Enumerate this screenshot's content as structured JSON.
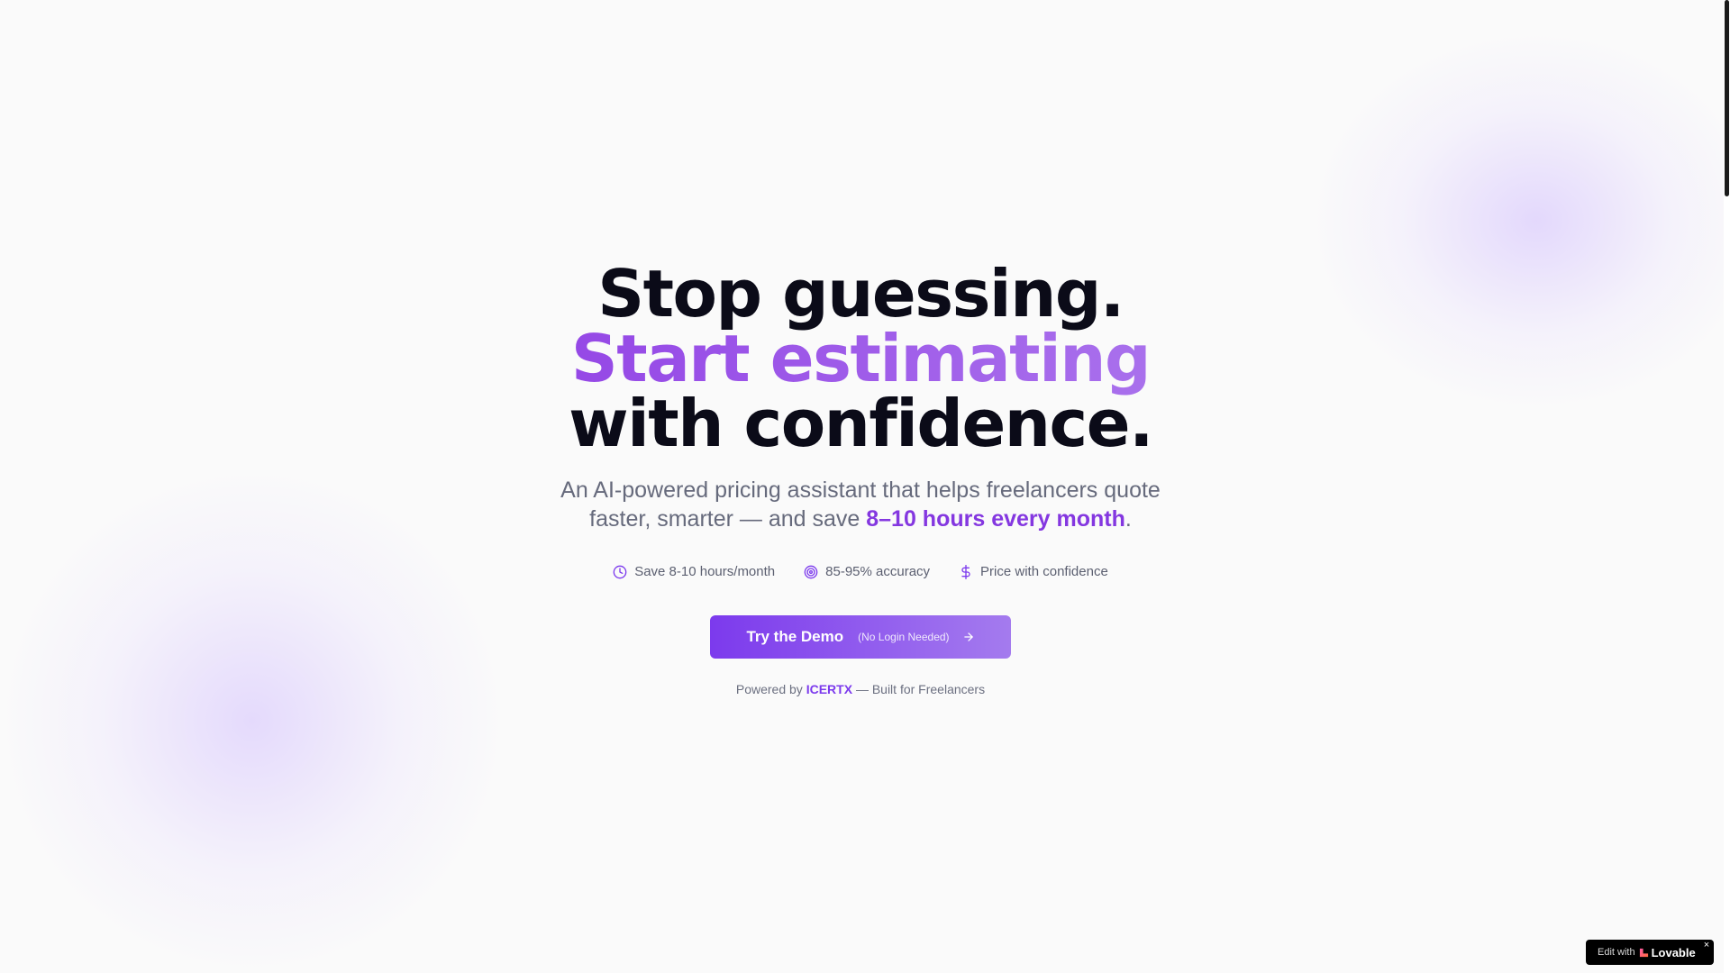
{
  "hero": {
    "headline_part1": "Stop guessing.",
    "headline_accent": "Start estimating",
    "headline_part2": "with confidence.",
    "subhead_part1": "An AI-powered pricing assistant that helps freelancers quote faster, smarter — and save",
    "subhead_highlight": "8–10 hours every month",
    "subhead_end": "."
  },
  "features": [
    {
      "icon": "clock-icon",
      "label": "Save 8-10 hours/month"
    },
    {
      "icon": "target-icon",
      "label": "85-95% accuracy"
    },
    {
      "icon": "dollar-icon",
      "label": "Price with confidence"
    }
  ],
  "cta": {
    "label": "Try the Demo",
    "note": "(No Login Needed)",
    "icon": "arrow-right-icon"
  },
  "powered": {
    "prefix": "Powered by",
    "brand": "ICERTX",
    "suffix": "— Built for Freelancers"
  },
  "lovable_badge": {
    "prefix": "Edit with",
    "brand": "Lovable",
    "close": "×"
  },
  "colors": {
    "accent": "#7c3aed",
    "accent_light": "#a970ec",
    "headline": "#0b0b18",
    "muted_text": "#666a7c",
    "background": "#fafafa"
  }
}
